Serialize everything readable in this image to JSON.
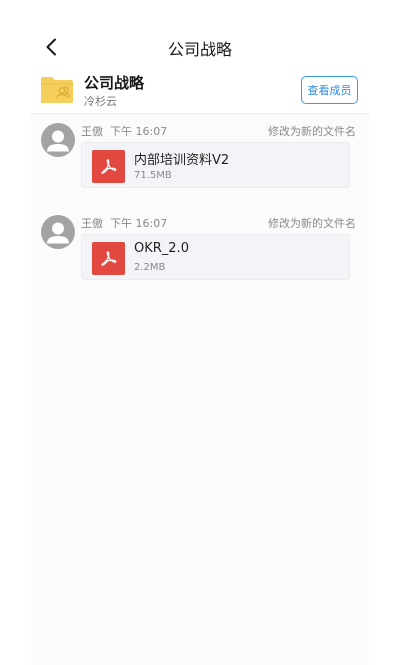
{
  "header": {
    "title": "公司战略",
    "back_icon": "chevron-left-icon"
  },
  "folder": {
    "name": "公司战略",
    "owner": "冷杉云",
    "members_button": "查看成员",
    "icon": "shared-folder-icon",
    "icon_color": "#F5CE5B",
    "accent_color": "#2F8DE0"
  },
  "activities": [
    {
      "user": "王傲",
      "time": "下午 16:07",
      "action": "修改为新的文件名",
      "file": {
        "name": "内部培训资料V2",
        "size": "71.5MB",
        "icon": "pdf-icon",
        "icon_color": "#E1483F"
      }
    },
    {
      "user": "王傲",
      "time": "下午 16:07",
      "action": "修改为新的文件名",
      "file": {
        "name": "OKR_2.0",
        "size": "2.2MB",
        "icon": "pdf-icon",
        "icon_color": "#E1483F"
      }
    }
  ]
}
